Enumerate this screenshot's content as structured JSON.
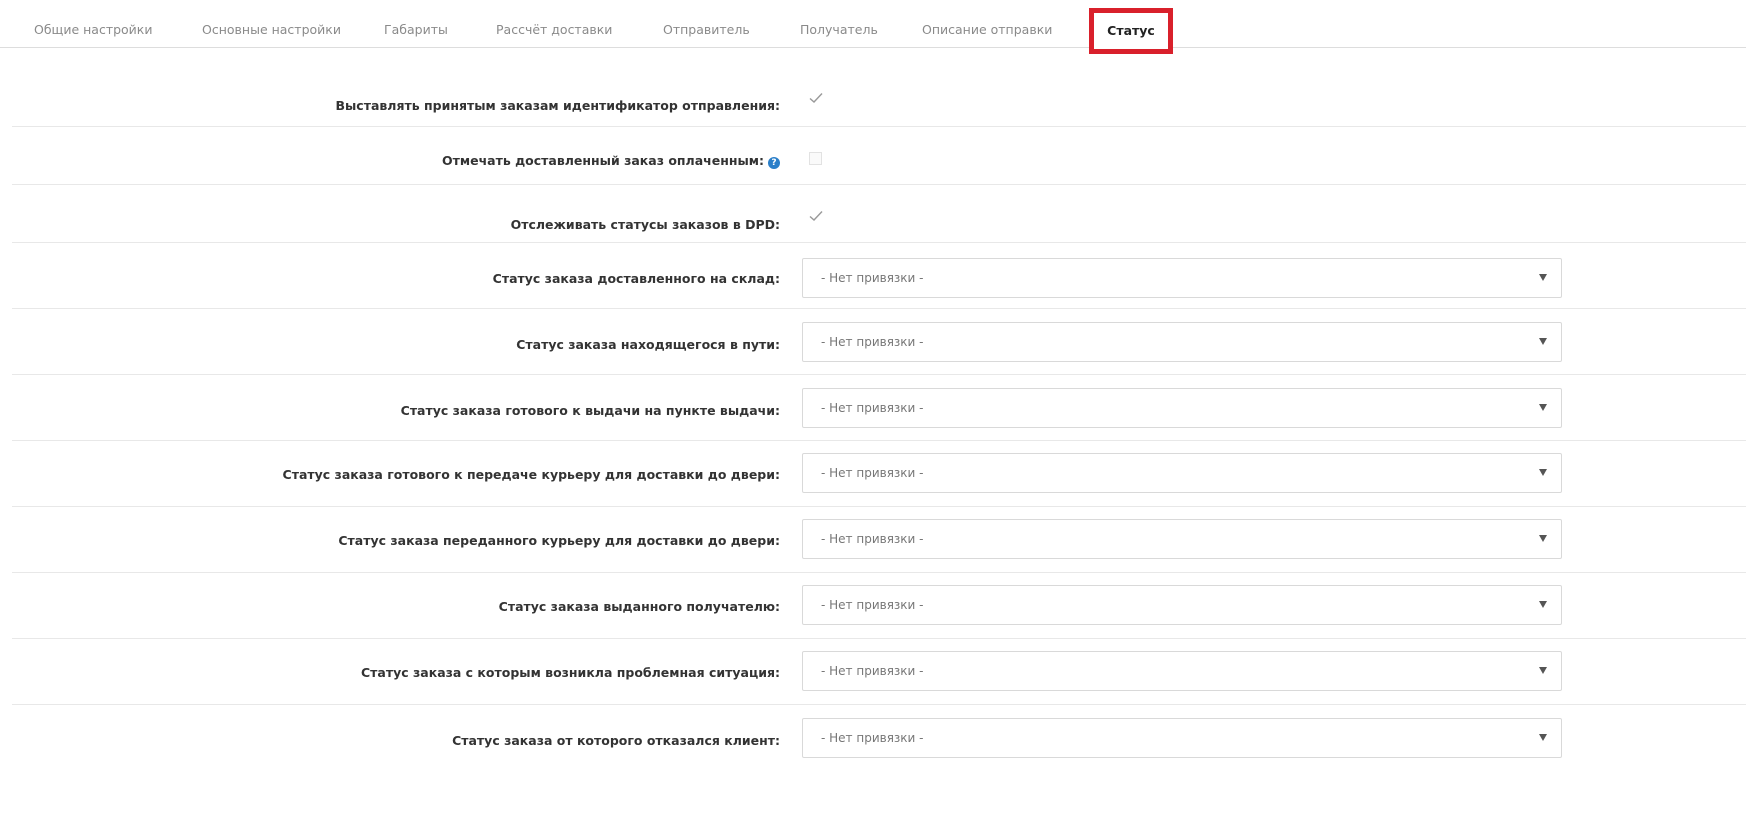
{
  "tabs": [
    {
      "label": "Общие настройки"
    },
    {
      "label": "Основные настройки"
    },
    {
      "label": "Габариты"
    },
    {
      "label": "Рассчёт доставки"
    },
    {
      "label": "Отправитель"
    },
    {
      "label": "Получатель"
    },
    {
      "label": "Описание отправки"
    },
    {
      "label": "Статус",
      "active": true
    }
  ],
  "settings": {
    "set_id": {
      "label": "Выставлять принятым заказам идентификатор отправления:",
      "checked": true
    },
    "mark_paid": {
      "label": "Отмечать доставленный заказ оплаченным:",
      "help_icon": "question-circle-icon",
      "checked": false
    },
    "track_dpd": {
      "label": "Отслеживать статусы заказов в DPD:",
      "checked": true
    }
  },
  "status_rows": [
    {
      "label": "Статус заказа доставленного на склад:",
      "value": "- Нет привязки -"
    },
    {
      "label": "Статус заказа находящегося в пути:",
      "value": "- Нет привязки -"
    },
    {
      "label": "Статус заказа готового к выдачи на пункте выдачи:",
      "value": "- Нет привязки -"
    },
    {
      "label": "Статус заказа готового к передаче курьеру для доставки до двери:",
      "value": "- Нет привязки -"
    },
    {
      "label": "Статус заказа переданного курьеру для доставки до двери:",
      "value": "- Нет привязки -"
    },
    {
      "label": "Статус заказа выданного получателю:",
      "value": "- Нет привязки -"
    },
    {
      "label": "Статус заказа с которым возникла проблемная ситуация:",
      "value": "- Нет привязки -"
    },
    {
      "label": "Статус заказа от которого отказался клиент:",
      "value": "- Нет привязки -"
    }
  ],
  "colors": {
    "active_tab_highlight": "#d9202b",
    "help_icon": "#2b7fc9"
  }
}
